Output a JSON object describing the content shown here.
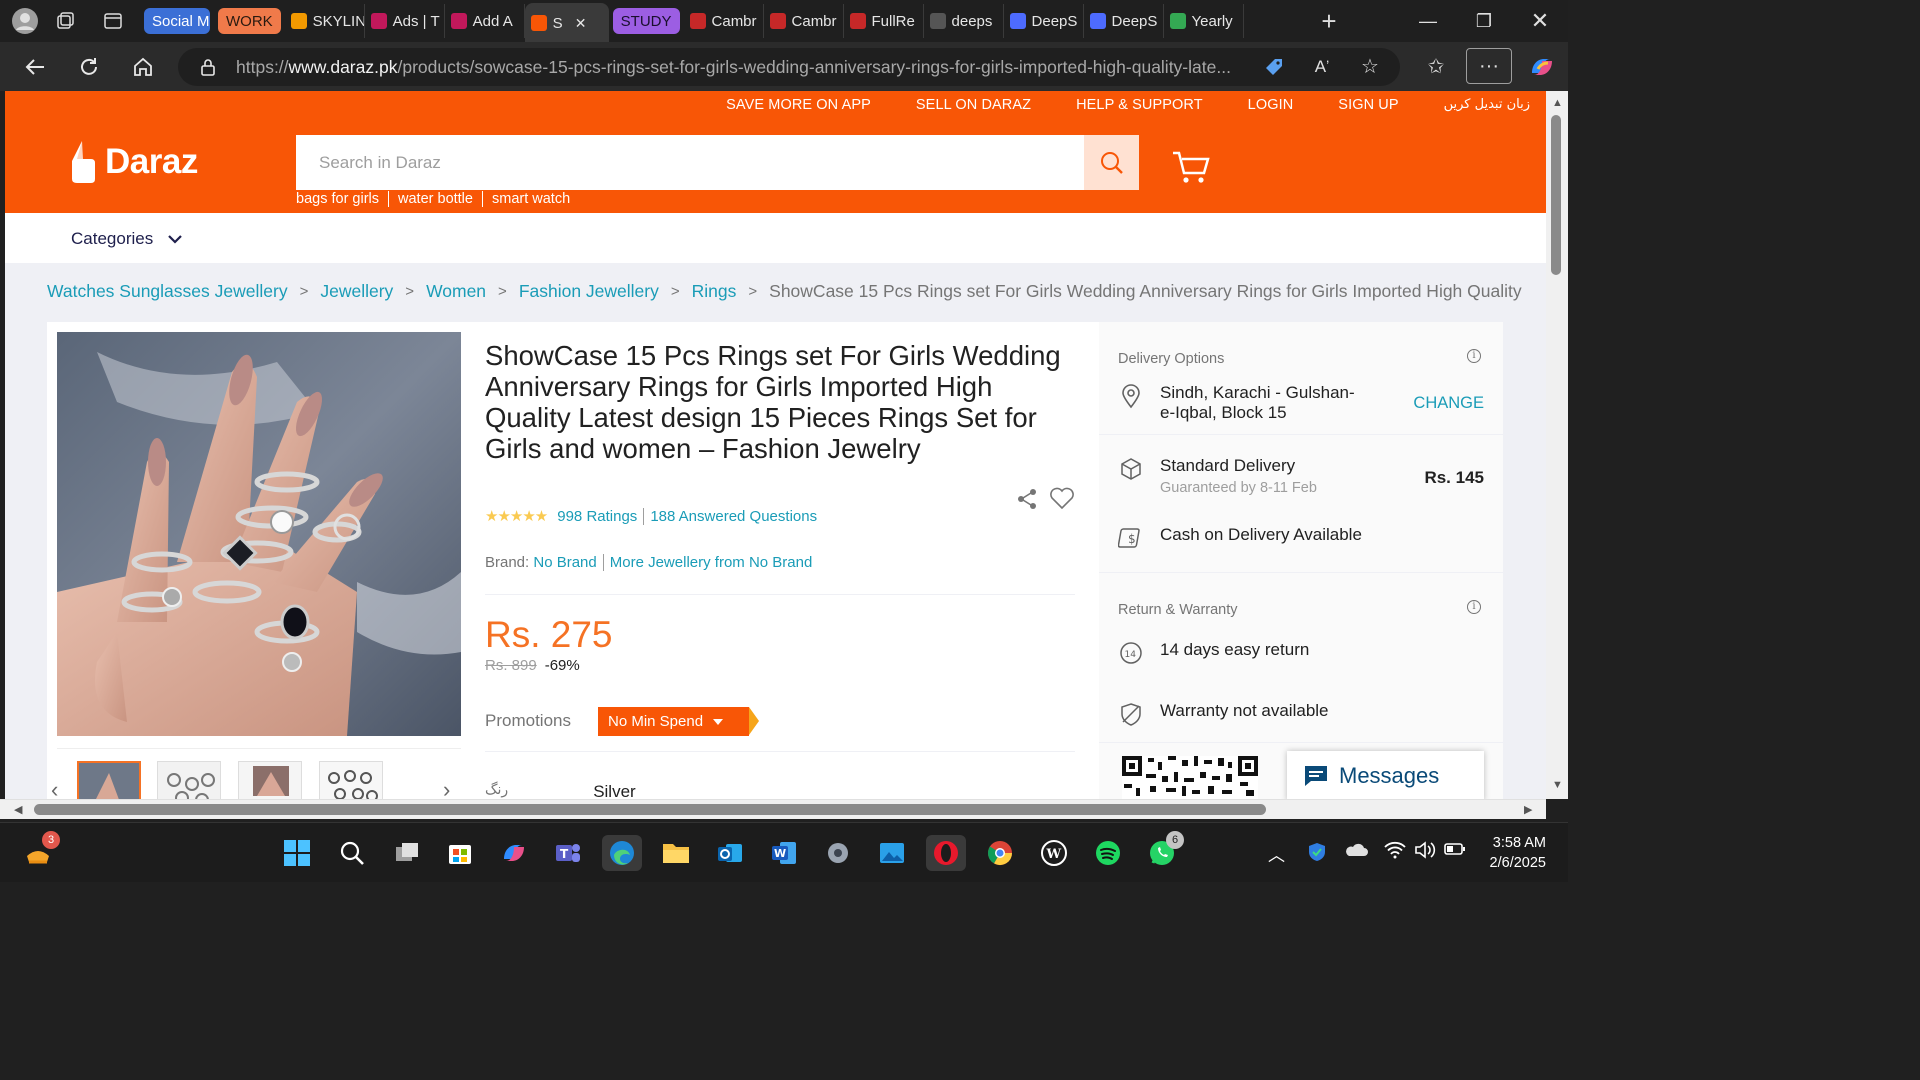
{
  "browser": {
    "tabs": [
      {
        "label": "Social M",
        "type": "group",
        "color": "#3b6fd6"
      },
      {
        "label": "WORK",
        "type": "group",
        "color": "#f07a4a"
      },
      {
        "label": "SKYLIN",
        "type": "tab",
        "color": "#f29900"
      },
      {
        "label": "Ads | T",
        "type": "tab",
        "color": "#c2185b"
      },
      {
        "label": "Add A",
        "type": "tab",
        "color": "#c2185b"
      },
      {
        "label": "S",
        "type": "active",
        "color": "#f85606"
      },
      {
        "label": "STUDY",
        "type": "group",
        "color": "#9c5ee3"
      },
      {
        "label": "Cambr",
        "type": "tab",
        "color": "#c62828"
      },
      {
        "label": "Cambr",
        "type": "tab",
        "color": "#c62828"
      },
      {
        "label": "FullRe",
        "type": "tab",
        "color": "#c62828"
      },
      {
        "label": "deeps",
        "type": "tab",
        "color": "#555555"
      },
      {
        "label": "DeepS",
        "type": "tab",
        "color": "#4d6bfe"
      },
      {
        "label": "DeepS",
        "type": "tab",
        "color": "#4d6bfe"
      },
      {
        "label": "Yearly",
        "type": "tab",
        "color": "#34a853"
      }
    ],
    "url_prefix": "https://",
    "url_domain": "www.daraz.pk",
    "url_path": "/products/sowcase-15-pcs-rings-set-for-girls-wedding-anniversary-rings-for-girls-imported-high-quality-late..."
  },
  "site": {
    "top_links": [
      "SAVE MORE ON APP",
      "SELL ON DARAZ",
      "HELP & SUPPORT",
      "LOGIN",
      "SIGN UP",
      "زبان تبدیل کریں"
    ],
    "logo_text": "Daraz",
    "search_placeholder": "Search in Daraz",
    "hot_words": [
      "bags for girls",
      "water bottle",
      "smart watch"
    ],
    "categories_label": "Categories",
    "brand_color": "#f85606"
  },
  "breadcrumb": {
    "items": [
      "Watches Sunglasses Jewellery",
      "Jewellery",
      "Women",
      "Fashion Jewellery",
      "Rings"
    ],
    "current": "ShowCase 15 Pcs Rings set For Girls Wedding Anniversary Rings for Girls Imported High Quality"
  },
  "product": {
    "title": "ShowCase 15 Pcs Rings set For Girls Wedding Anniversary Rings for Girls Imported High Quality Latest design 15 Pieces Rings Set for Girls and women – Fashion Jewelry",
    "stars": "★★★★★",
    "ratings": "998 Ratings",
    "answered": "188 Answered Questions",
    "brand_label": "Brand:",
    "brand": "No Brand",
    "more_from": "More Jewellery from No Brand",
    "price": "Rs. 275",
    "original_price": "Rs. 899",
    "discount": "-69%",
    "promotions_label": "Promotions",
    "promo_badge": "No Min Spend",
    "color_label": "رنگ",
    "color_value": "Silver"
  },
  "delivery": {
    "title": "Delivery Options",
    "location": "Sindh, Karachi - Gulshan-e-Iqbal, Block 15",
    "change": "CHANGE",
    "standard_label": "Standard Delivery",
    "standard_sub": "Guaranteed by 8-11 Feb",
    "standard_fee": "Rs. 145",
    "cod": "Cash on Delivery Available"
  },
  "warranty": {
    "title": "Return & Warranty",
    "return": "14 days easy return",
    "warranty": "Warranty not available"
  },
  "messages_label": "Messages",
  "taskbar": {
    "time": "3:58 AM",
    "date": "2/6/2025",
    "widget_badge": "3",
    "whatsapp_badge": "6"
  }
}
